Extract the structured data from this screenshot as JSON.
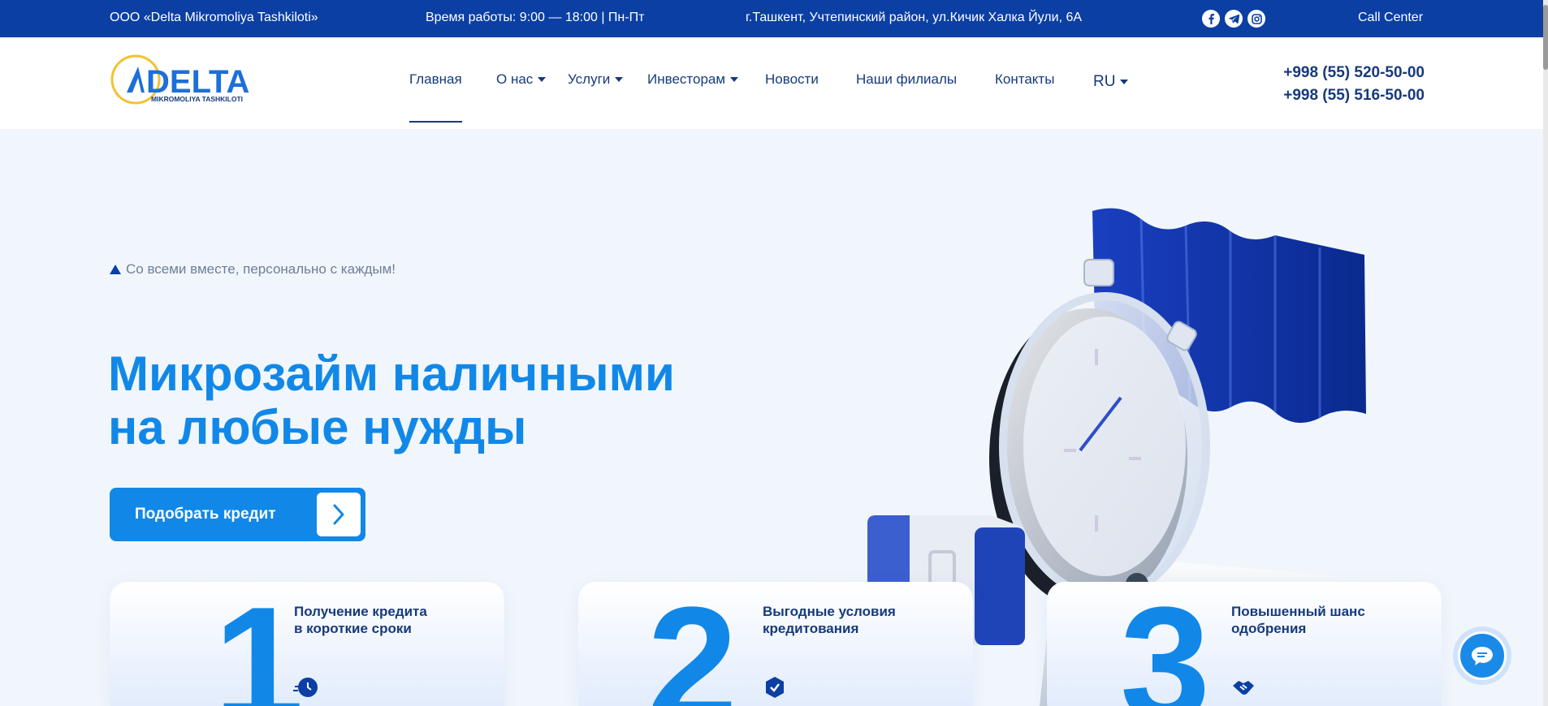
{
  "topbar": {
    "company": "ООО «Delta Mikromoliya Tashkiloti»",
    "hours": "Время работы: 9:00 — 18:00 | Пн-Пт",
    "address": "г.Ташкент, Учтепинский район, ул.Кичик Халка Йули, 6А",
    "call_center": "Call Center"
  },
  "logo": {
    "brand": "DELTA",
    "sub": "MIKROMOLIYA TASHKILOTI"
  },
  "nav": {
    "home": "Главная",
    "about": "О нас",
    "services": "Услуги",
    "investors": "Инвесторам",
    "news": "Новости",
    "branches": "Наши филиалы",
    "contacts": "Контакты",
    "lang": "RU"
  },
  "phones": [
    "+998 (55) 520-50-00",
    "+998 (55) 516-50-00"
  ],
  "hero": {
    "tagline": "Со всеми вместе, персонально с каждым!",
    "title_line1": "Микрозайм наличными",
    "title_line2": "на любые нужды",
    "cta": "Подобрать кредит"
  },
  "cards": [
    {
      "num": "1",
      "text": "Получение кредита\nв короткие сроки"
    },
    {
      "num": "2",
      "text": "Выгодные условия\nкредитования"
    },
    {
      "num": "3",
      "text": "Повышенный шанс\nодобрения"
    }
  ],
  "colors": {
    "primary": "#1188e8",
    "dark": "#0b3fa3",
    "text": "#163a7c"
  }
}
